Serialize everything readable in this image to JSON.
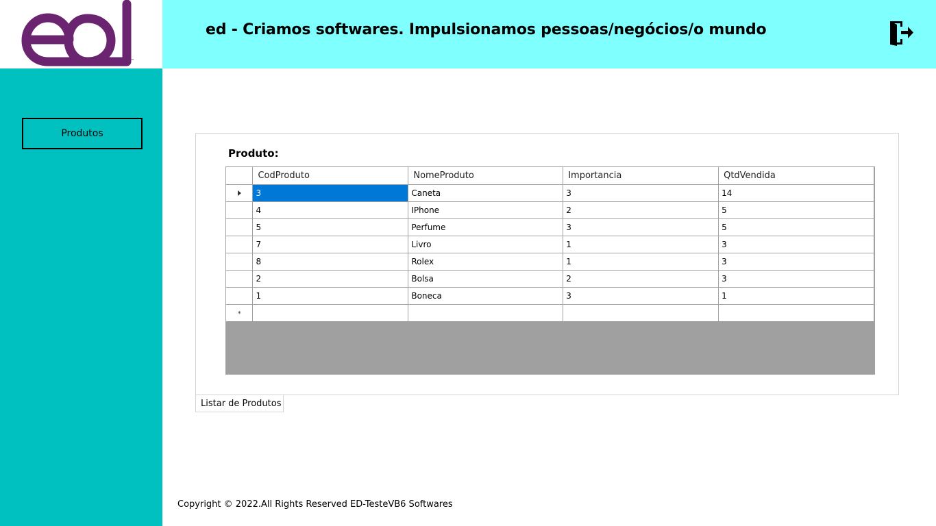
{
  "brand": {
    "logo_text": "ed",
    "trademark": "™",
    "logo_color": "#6b2570"
  },
  "header": {
    "title": "ed - Criamos softwares. Impulsionamos pessoas/negócios/o mundo",
    "background": "#80ffff",
    "logout_icon": "logout-door-icon"
  },
  "sidebar": {
    "background": "#00c0c0",
    "items": [
      {
        "label": "Produtos"
      }
    ]
  },
  "main": {
    "panel_label": "Produto:",
    "grid": {
      "columns": [
        "CodProduto",
        "NomeProduto",
        "Importancia",
        "QtdVendida"
      ],
      "rows": [
        [
          "3",
          "Caneta",
          "3",
          "14"
        ],
        [
          "4",
          "IPhone",
          "2",
          "5"
        ],
        [
          "5",
          "Perfume",
          "3",
          "5"
        ],
        [
          "7",
          "Livro",
          "1",
          "3"
        ],
        [
          "8",
          "Rolex",
          "1",
          "3"
        ],
        [
          "2",
          "Bolsa",
          "2",
          "3"
        ],
        [
          "1",
          "Boneca",
          "3",
          "1"
        ]
      ],
      "selected_row": 0,
      "new_row_marker": "*",
      "selection_color": "#0078d7"
    },
    "tabs": [
      {
        "label": "Listar de Produtos",
        "active": true
      }
    ]
  },
  "footer": {
    "copyright": "Copyright © 2022.All Rights Reserved ED-TesteVB6 Softwares"
  }
}
